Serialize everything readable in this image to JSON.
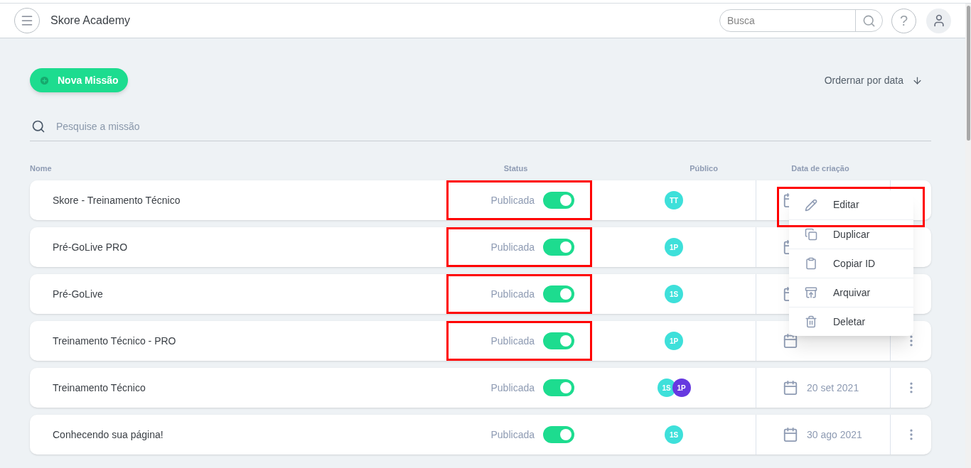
{
  "header": {
    "title": "Skore Academy",
    "search": {
      "placeholder": "Busca"
    },
    "help": "?"
  },
  "new_button": "Nova Missão",
  "sort": "Ordernar por data",
  "mission_search": {
    "placeholder": "Pesquise a missão"
  },
  "columns": [
    "Nome",
    "Status",
    "Público",
    "Data de criação"
  ],
  "rows": [
    {
      "name": "Skore - Treinamento Técnico",
      "status": "Publicada",
      "on": true,
      "highlighted": true,
      "audience": [
        {
          "label": "TT",
          "color": "#3ee0da"
        }
      ],
      "date": null,
      "menu_visible": false
    },
    {
      "name": "Pré-GoLive PRO",
      "status": "Publicada",
      "on": true,
      "highlighted": true,
      "audience": [
        {
          "label": "1P",
          "color": "#3ee0da"
        }
      ],
      "date": null,
      "menu_visible": false
    },
    {
      "name": "Pré-GoLive",
      "status": "Publicada",
      "on": true,
      "highlighted": true,
      "audience": [
        {
          "label": "1S",
          "color": "#3ee0da"
        }
      ],
      "date": null,
      "menu_visible": false
    },
    {
      "name": "Treinamento Técnico - PRO",
      "status": "Publicada",
      "on": true,
      "highlighted": true,
      "audience": [
        {
          "label": "1P",
          "color": "#3ee0da"
        }
      ],
      "date": null,
      "menu_visible": true
    },
    {
      "name": "Treinamento Técnico",
      "status": "Publicada",
      "on": true,
      "highlighted": false,
      "audience": [
        {
          "label": "1S",
          "color": "#3ee0da"
        },
        {
          "label": "1P",
          "color": "#6639e0"
        }
      ],
      "date": "20 set 2021",
      "menu_visible": true
    },
    {
      "name": "Conhecendo sua página!",
      "status": "Publicada",
      "on": true,
      "highlighted": false,
      "audience": [
        {
          "label": "1S",
          "color": "#3ee0da"
        }
      ],
      "date": "30 ago 2021",
      "menu_visible": true
    }
  ],
  "context_menu": [
    {
      "kind": "edit",
      "label": "Editar",
      "highlighted": true
    },
    {
      "kind": "duplicate",
      "label": "Duplicar",
      "highlighted": false
    },
    {
      "kind": "copy_id",
      "label": "Copiar ID",
      "highlighted": false
    },
    {
      "kind": "archive",
      "label": "Arquivar",
      "highlighted": false
    },
    {
      "kind": "delete",
      "label": "Deletar",
      "highlighted": false
    }
  ]
}
